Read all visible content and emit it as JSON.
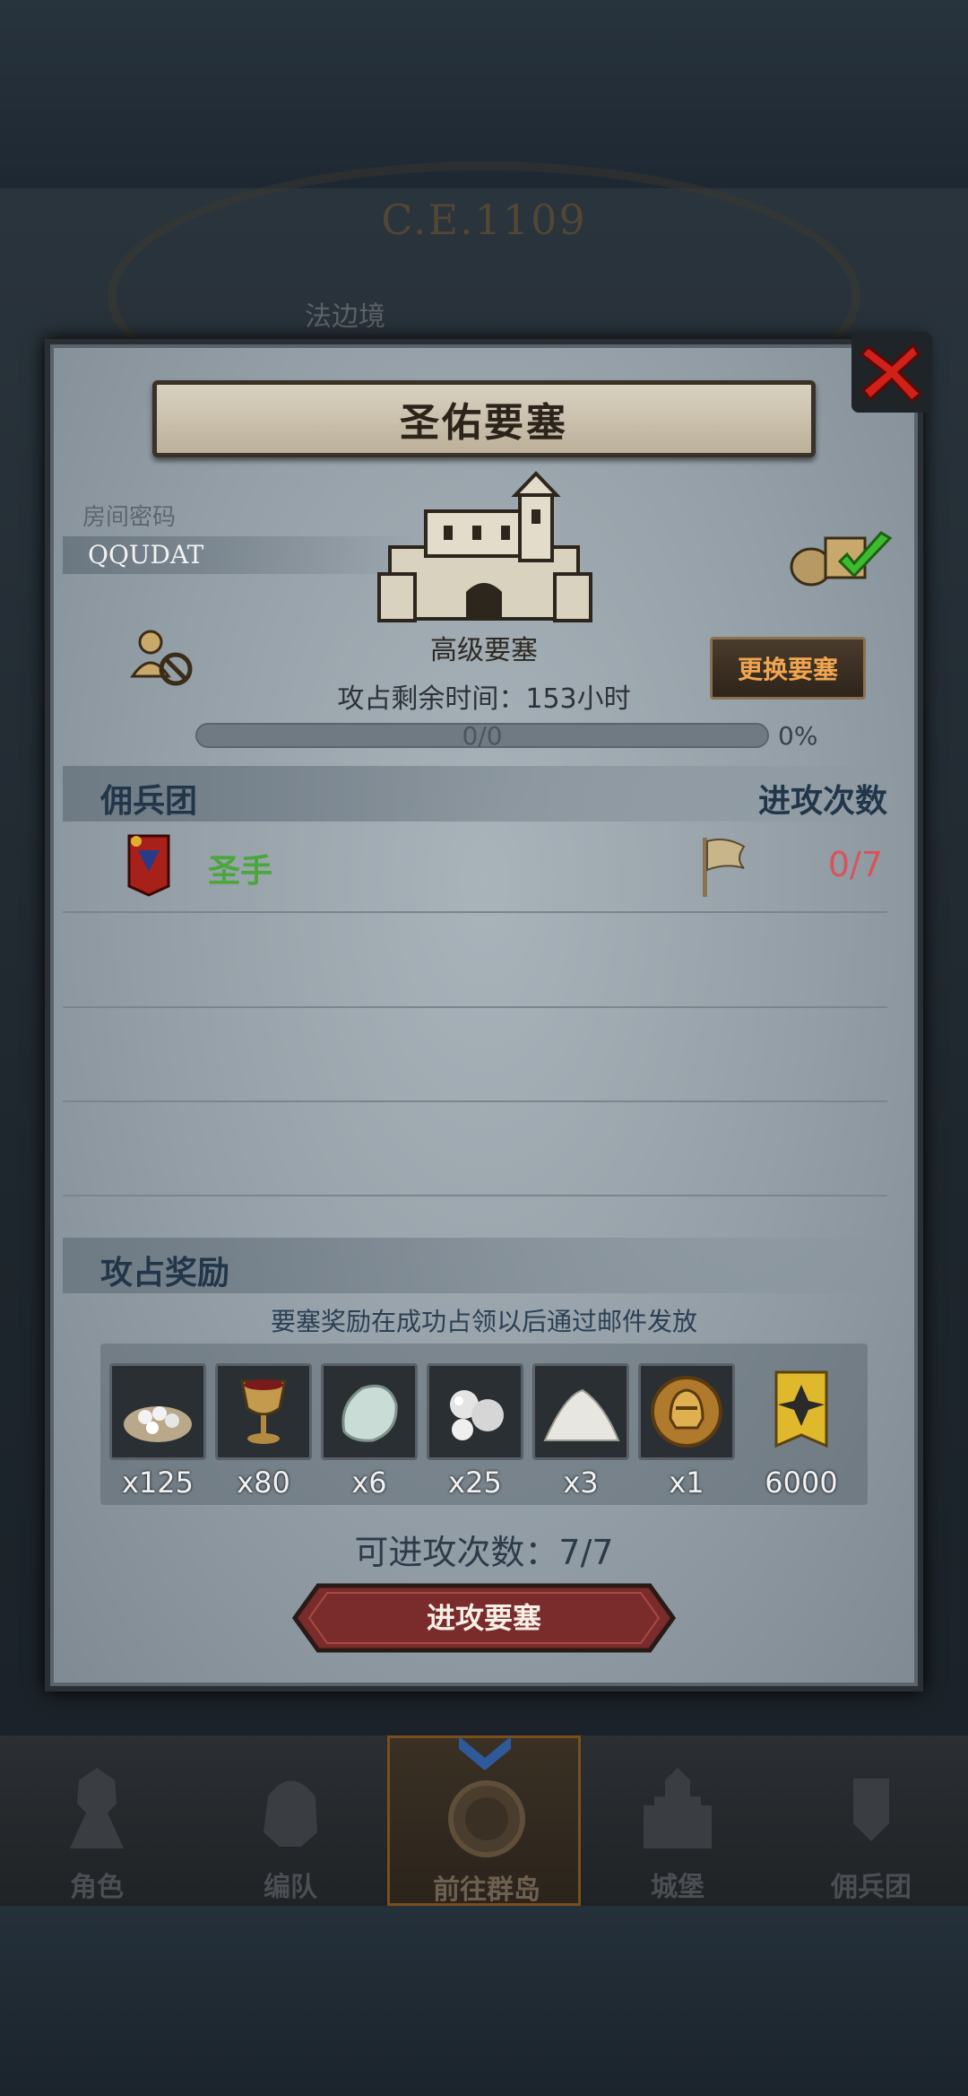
{
  "background": {
    "era": "C.E.1109",
    "place": "法边境"
  },
  "dialog": {
    "title": "圣佑要塞",
    "room_label": "房间密码",
    "room_code": "QQUDAT",
    "fortress_grade": "高级要塞",
    "time_left": "攻占剩余时间：153小时",
    "change_button": "更换要塞",
    "progress": {
      "text": "0/0",
      "percent_label": "0%",
      "fraction": 0
    },
    "mercenary_header": "佣兵团",
    "attack_count_header": "进攻次数",
    "mercenaries": [
      {
        "name": "圣手",
        "attacks": "0/7"
      }
    ],
    "rewards_header": "攻占奖励",
    "reward_note": "要塞奖励在成功占领以后通过邮件发放",
    "rewards": [
      {
        "icon": "silver-pile-icon",
        "qty": "x125"
      },
      {
        "icon": "goblet-icon",
        "qty": "x80"
      },
      {
        "icon": "white-stone-icon",
        "qty": "x6"
      },
      {
        "icon": "pearl-icon",
        "qty": "x25"
      },
      {
        "icon": "salt-pile-icon",
        "qty": "x3"
      },
      {
        "icon": "helmet-medal-icon",
        "qty": "x1"
      },
      {
        "icon": "honor-banner-icon",
        "qty": "6000"
      }
    ],
    "attacks_left": "可进攻次数：7/7",
    "attack_button": "进攻要塞"
  },
  "nav": {
    "items": [
      {
        "label": "角色",
        "icon": "knight-icon"
      },
      {
        "label": "编队",
        "icon": "helmet-icon"
      },
      {
        "label": "前往群岛",
        "icon": "compass-icon",
        "active": true
      },
      {
        "label": "城堡",
        "icon": "castle-icon"
      },
      {
        "label": "佣兵团",
        "icon": "mercenary-icon"
      }
    ]
  },
  "colors": {
    "merc_name": "#49a73c",
    "attack_count": "#d8545a",
    "change_button_text": "#f0a550",
    "attack_button": "#7a2b2b"
  }
}
